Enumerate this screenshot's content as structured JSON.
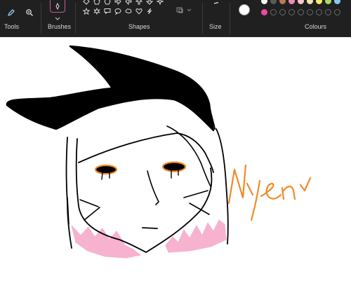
{
  "ribbon": {
    "tools": {
      "label": "Tools"
    },
    "brushes": {
      "label": "Brushes"
    },
    "shapes": {
      "label": "Shapes"
    },
    "size": {
      "label": "Size"
    },
    "colours": {
      "label": "Colours",
      "primary_color": "#ffffff",
      "top_row": [
        "#f4f4f4",
        "#5a5a5a",
        "#b97a56",
        "#f08bb4",
        "#f6c6cd",
        "#f4e2b2",
        "#f6e86b",
        "#a6d86a",
        "#86c8f0"
      ],
      "bottom_row_selected": "#e94aa0"
    }
  },
  "canvas": {
    "text_color": "#f08a28",
    "drawing_colors": {
      "ink": "#000000",
      "pink": "#f6b2cf",
      "orange": "#f08a28"
    }
  }
}
